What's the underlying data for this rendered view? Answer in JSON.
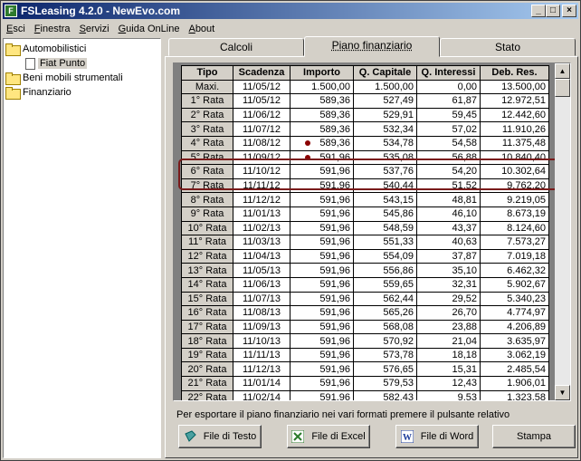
{
  "window": {
    "title": "FSLeasing 4.2.0 - NewEvo.com"
  },
  "menu": [
    "Esci",
    "Finestra",
    "Servizi",
    "Guida OnLine",
    "About"
  ],
  "tree": {
    "items": [
      {
        "label": "Automobilistici"
      },
      {
        "label": "Fiat Punto"
      },
      {
        "label": "Beni mobili strumentali"
      },
      {
        "label": "Finanziario"
      }
    ]
  },
  "tabs": [
    {
      "label": "Calcoli"
    },
    {
      "label": "Piano finanziario"
    },
    {
      "label": "Stato"
    }
  ],
  "table": {
    "headers": [
      "Tipo",
      "Scadenza",
      "Importo",
      "Q. Capitale",
      "Q. Interessi",
      "Deb. Res."
    ],
    "rows": [
      [
        "Maxi.",
        "11/05/12",
        "1.500,00",
        "1.500,00",
        "0,00",
        "13.500,00"
      ],
      [
        "1° Rata",
        "11/05/12",
        "589,36",
        "527,49",
        "61,87",
        "12.972,51"
      ],
      [
        "2° Rata",
        "11/06/12",
        "589,36",
        "529,91",
        "59,45",
        "12.442,60"
      ],
      [
        "3° Rata",
        "11/07/12",
        "589,36",
        "532,34",
        "57,02",
        "11.910,26"
      ],
      [
        "4° Rata",
        "11/08/12",
        "589,36",
        "534,78",
        "54,58",
        "11.375,48"
      ],
      [
        "5° Rata",
        "11/09/12",
        "591,96",
        "535,08",
        "56,88",
        "10.840,40"
      ],
      [
        "6° Rata",
        "11/10/12",
        "591,96",
        "537,76",
        "54,20",
        "10.302,64"
      ],
      [
        "7° Rata",
        "11/11/12",
        "591,96",
        "540,44",
        "51,52",
        "9.762,20"
      ],
      [
        "8° Rata",
        "11/12/12",
        "591,96",
        "543,15",
        "48,81",
        "9.219,05"
      ],
      [
        "9° Rata",
        "11/01/13",
        "591,96",
        "545,86",
        "46,10",
        "8.673,19"
      ],
      [
        "10° Rata",
        "11/02/13",
        "591,96",
        "548,59",
        "43,37",
        "8.124,60"
      ],
      [
        "11° Rata",
        "11/03/13",
        "591,96",
        "551,33",
        "40,63",
        "7.573,27"
      ],
      [
        "12° Rata",
        "11/04/13",
        "591,96",
        "554,09",
        "37,87",
        "7.019,18"
      ],
      [
        "13° Rata",
        "11/05/13",
        "591,96",
        "556,86",
        "35,10",
        "6.462,32"
      ],
      [
        "14° Rata",
        "11/06/13",
        "591,96",
        "559,65",
        "32,31",
        "5.902,67"
      ],
      [
        "15° Rata",
        "11/07/13",
        "591,96",
        "562,44",
        "29,52",
        "5.340,23"
      ],
      [
        "16° Rata",
        "11/08/13",
        "591,96",
        "565,26",
        "26,70",
        "4.774,97"
      ],
      [
        "17° Rata",
        "11/09/13",
        "591,96",
        "568,08",
        "23,88",
        "4.206,89"
      ],
      [
        "18° Rata",
        "11/10/13",
        "591,96",
        "570,92",
        "21,04",
        "3.635,97"
      ],
      [
        "19° Rata",
        "11/11/13",
        "591,96",
        "573,78",
        "18,18",
        "3.062,19"
      ],
      [
        "20° Rata",
        "11/12/13",
        "591,96",
        "576,65",
        "15,31",
        "2.485,54"
      ],
      [
        "21° Rata",
        "11/01/14",
        "591,96",
        "579,53",
        "12,43",
        "1.906,01"
      ],
      [
        "22° Rata",
        "11/02/14",
        "591,96",
        "582,43",
        "9,53",
        "1.323,58"
      ]
    ],
    "marked_rows": [
      4,
      5
    ],
    "highlight_color": "#7a1b1b"
  },
  "export": {
    "text": "Per esportare il piano finanziario nei vari formati premere il pulsante relativo",
    "buttons": [
      {
        "label": "File di Testo",
        "icon": "text-file-icon"
      },
      {
        "label": "File di Excel",
        "icon": "excel-icon"
      },
      {
        "label": "File di Word",
        "icon": "word-icon"
      },
      {
        "label": "Stampa",
        "icon": ""
      }
    ]
  }
}
